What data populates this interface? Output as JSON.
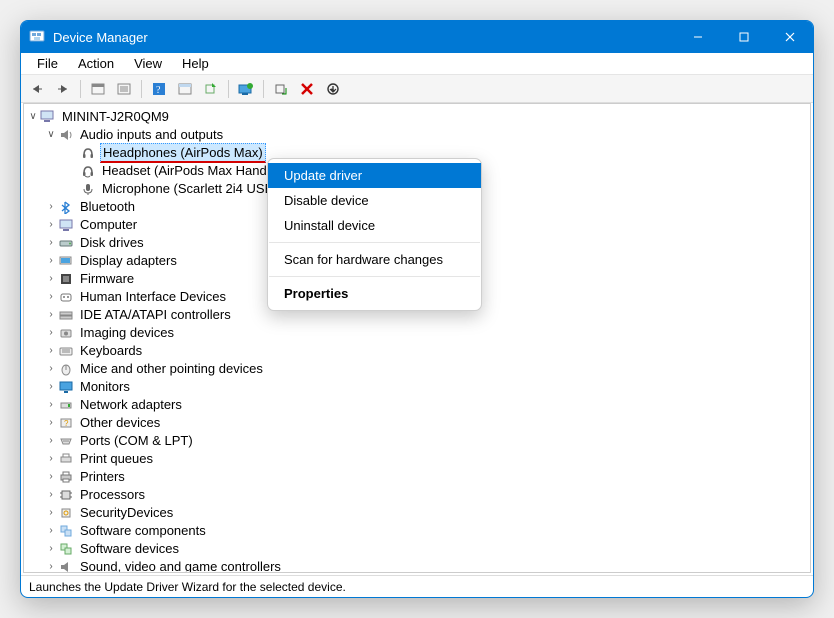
{
  "window": {
    "title": "Device Manager"
  },
  "menubar": [
    "File",
    "Action",
    "View",
    "Help"
  ],
  "root_node": "MININT-J2R0QM9",
  "audio_category": "Audio inputs and outputs",
  "audio_children": [
    "Headphones (AirPods Max)",
    "Headset (AirPods Max Hands-Free)",
    "Microphone (Scarlett 2i4 USB)"
  ],
  "categories": [
    "Bluetooth",
    "Computer",
    "Disk drives",
    "Display adapters",
    "Firmware",
    "Human Interface Devices",
    "IDE ATA/ATAPI controllers",
    "Imaging devices",
    "Keyboards",
    "Mice and other pointing devices",
    "Monitors",
    "Network adapters",
    "Other devices",
    "Ports (COM & LPT)",
    "Print queues",
    "Printers",
    "Processors",
    "SecurityDevices",
    "Software components",
    "Software devices",
    "Sound, video and game controllers"
  ],
  "context_menu": {
    "update": "Update driver",
    "disable": "Disable device",
    "uninstall": "Uninstall device",
    "scan": "Scan for hardware changes",
    "props": "Properties"
  },
  "statusbar": "Launches the Update Driver Wizard for the selected device."
}
